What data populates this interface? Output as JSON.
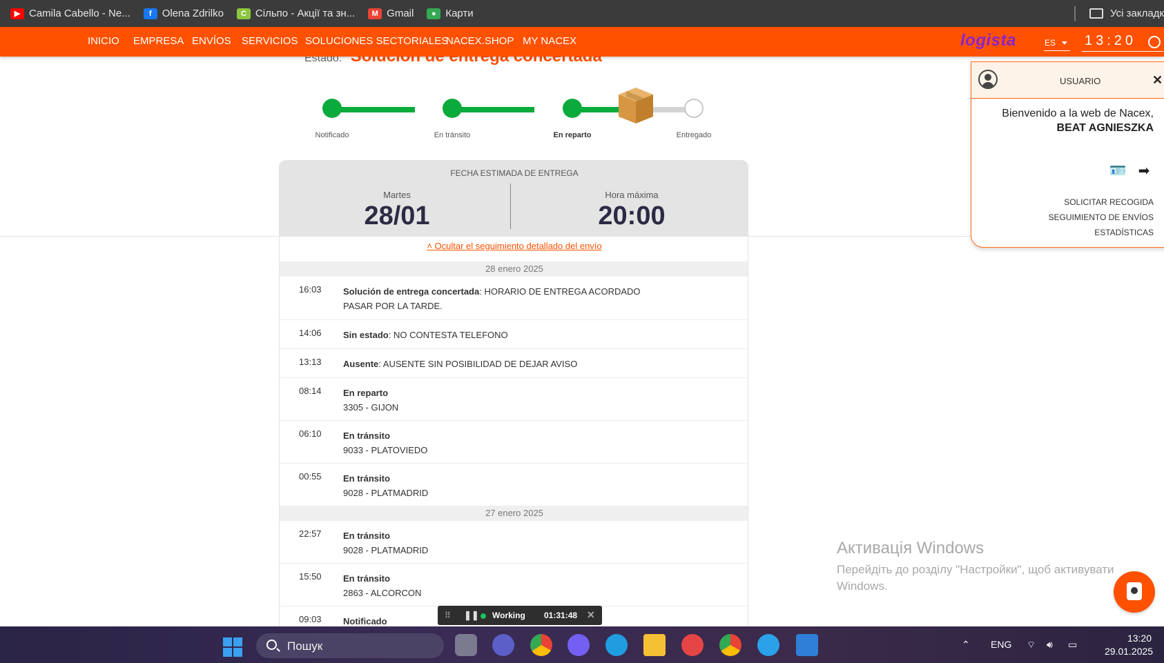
{
  "browser": {
    "bookmarks": [
      {
        "label": "Camila Cabello - Ne...",
        "icon": "youtube-icon",
        "color": "#ff0000"
      },
      {
        "label": "Olena Zdrilko",
        "icon": "facebook-icon",
        "color": "#1877f2"
      },
      {
        "label": "Сільпо - Акції та зн...",
        "icon": "silpo-icon",
        "color": "#8cc63f"
      },
      {
        "label": "Gmail",
        "icon": "gmail-icon",
        "color": "#ea4335"
      },
      {
        "label": "Карти",
        "icon": "maps-icon",
        "color": "#34a853"
      }
    ],
    "all_bookmarks": "Усі закладк"
  },
  "nav": {
    "items": [
      "INICIO",
      "EMPRESA",
      "ENVÍOS",
      "SERVICIOS",
      "SOLUCIONES SECTORIALES",
      "NACEX.SHOP",
      "MY NACEX"
    ],
    "logo": "logista",
    "language": "ES",
    "clock": "13:20",
    "accent_color": "#ff5100"
  },
  "shipment": {
    "estado_label": "Estado:",
    "estado_value": "Solución de entrega concertada",
    "steps": [
      {
        "label": "Notificado",
        "done": true,
        "current": false
      },
      {
        "label": "En tránsito",
        "done": true,
        "current": false
      },
      {
        "label": "En reparto",
        "done": true,
        "current": true
      },
      {
        "label": "Entregado",
        "done": false,
        "current": false
      }
    ],
    "estimate": {
      "title": "FECHA ESTIMADA DE ENTREGA",
      "day_label": "Martes",
      "date": "28/01",
      "hour_label": "Hora máxima",
      "hour": "20:00"
    },
    "toggle_link": "˄ Ocultar el seguimiento detallado del envío",
    "days": [
      {
        "date": "28 enero 2025",
        "events": [
          {
            "time": "16:03",
            "title": "Solución de entrega concertada",
            "detail": ": HORARIO DE ENTREGA ACORDADO",
            "line2": "PASAR POR LA TARDE."
          },
          {
            "time": "14:06",
            "title": "Sin estado",
            "detail": ": NO CONTESTA TELEFONO",
            "line2": ""
          },
          {
            "time": "13:13",
            "title": "Ausente",
            "detail": ": AUSENTE SIN POSIBILIDAD DE DEJAR AVISO",
            "line2": ""
          },
          {
            "time": "08:14",
            "title": "En reparto",
            "detail": "",
            "line2": "3305 - GIJON"
          },
          {
            "time": "06:10",
            "title": "En tránsito",
            "detail": "",
            "line2": "9033 - PLATOVIEDO"
          },
          {
            "time": "00:55",
            "title": "En tránsito",
            "detail": "",
            "line2": "9028 - PLATMADRID"
          }
        ]
      },
      {
        "date": "27 enero 2025",
        "events": [
          {
            "time": "22:57",
            "title": "En tránsito",
            "detail": "",
            "line2": "9028 - PLATMADRID"
          },
          {
            "time": "15:50",
            "title": "En tránsito",
            "detail": "",
            "line2": "2863 - ALCORCON"
          },
          {
            "time": "09:03",
            "title": "Notificado",
            "detail": "",
            "line2": ""
          }
        ]
      }
    ]
  },
  "user_panel": {
    "title": "USUARIO",
    "welcome": "Bienvenido a la web de Nacex,",
    "name": "BEAT AGNIESZKA",
    "links": [
      "SOLICITAR RECOGIDA",
      "SEGUIMIENTO DE ENVÍOS",
      "ESTADÍSTICAS"
    ]
  },
  "watermark": {
    "title": "Активація Windows",
    "subtitle": "Перейдіть до розділу \"Настройки\", щоб активувати Windows."
  },
  "timer": {
    "state": "Working",
    "elapsed": "01:31:48"
  },
  "taskbar": {
    "search_label": "Пошук",
    "language": "ENG",
    "time": "13:20",
    "date": "29.01.2025"
  }
}
